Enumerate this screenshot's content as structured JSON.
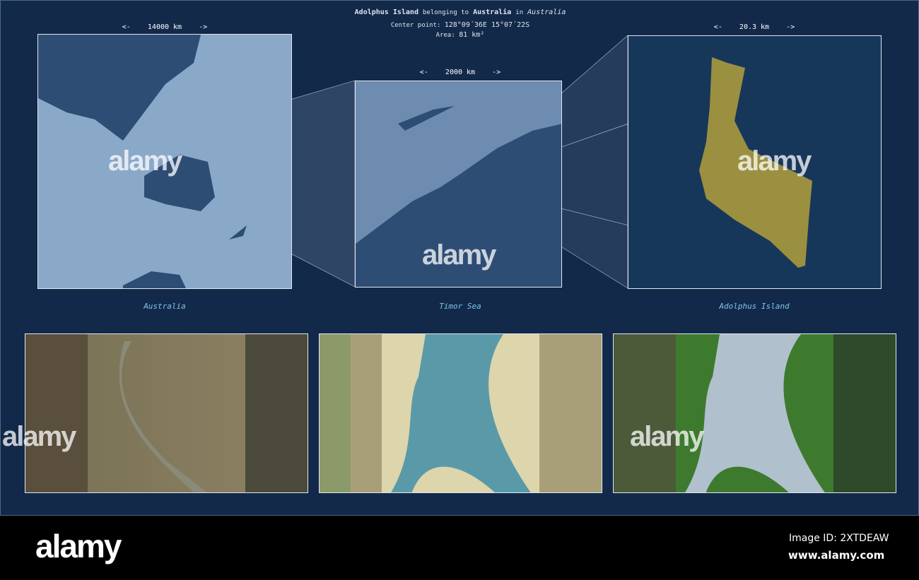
{
  "header": {
    "name": "Adolphus Island",
    "belonging": "belonging to",
    "country": "Australia",
    "in": "in",
    "region": "Australia",
    "center_label": "Center point:",
    "center_value": "128°09´36E  15°07´22S",
    "area_label": "Area:",
    "area_value": "81 km²"
  },
  "maps": [
    {
      "scale": "<-    14000 km    ->",
      "label": "Australia"
    },
    {
      "scale": "<-    2000 km    ->",
      "label": "Timor Sea"
    },
    {
      "scale": "<-    20.3 km    ->",
      "label": "Adolphus Island"
    }
  ],
  "watermark": "alamy",
  "footer": {
    "logo": "alamy",
    "image_id": "Image ID: 2XTDEAW",
    "url": "www.alamy.com"
  },
  "colors": {
    "background": "#13294a",
    "island": "#9a9040",
    "sea": "#1a3a5e"
  }
}
